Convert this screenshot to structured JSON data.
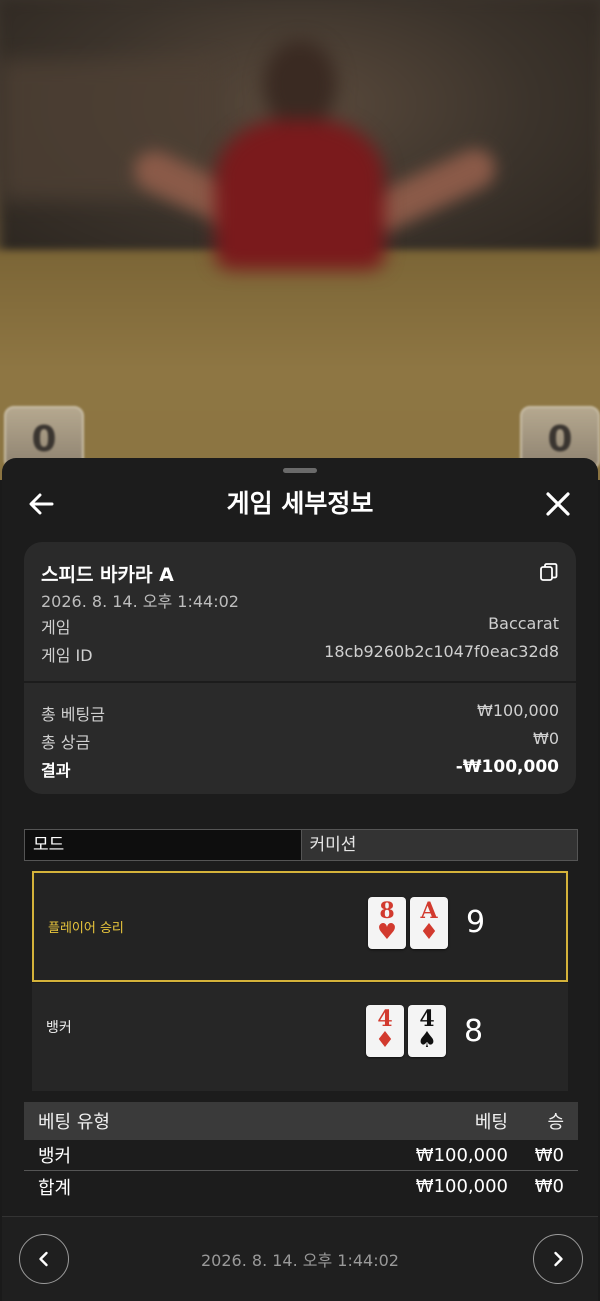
{
  "video": {
    "player_score": "0",
    "banker_score": "0"
  },
  "header": {
    "title": "게임 세부정보"
  },
  "round": {
    "table_name": "스피드 바카라 A",
    "datetime": "2026. 8. 14. 오후 1:44:02",
    "game_label": "게임",
    "game_value": "Baccarat",
    "game_id_label": "게임 ID",
    "game_id_value": "18cb9260b2c1047f0eac32d8"
  },
  "totals": {
    "total_bet_label": "총 베팅금",
    "total_bet_value": "₩100,000",
    "total_payout_label": "총 상금",
    "total_payout_value": "₩0",
    "result_label": "결과",
    "result_value": "-₩100,000"
  },
  "mode": {
    "mode_label": "모드",
    "mode_value": "커미션"
  },
  "hands": {
    "player": {
      "label": "플레이어 승리",
      "score": "9",
      "cards": [
        {
          "rank": "8",
          "suit": "♥",
          "color": "red"
        },
        {
          "rank": "A",
          "suit": "♦",
          "color": "red"
        }
      ]
    },
    "banker": {
      "label": "뱅커",
      "score": "8",
      "cards": [
        {
          "rank": "4",
          "suit": "♦",
          "color": "red"
        },
        {
          "rank": "4",
          "suit": "♠",
          "color": "black"
        }
      ]
    }
  },
  "bets": {
    "headers": {
      "type": "베팅 유형",
      "bet": "베팅",
      "win": "승"
    },
    "rows": [
      {
        "type": "뱅커",
        "bet": "₩100,000",
        "win": "₩0"
      }
    ],
    "total": {
      "type": "합계",
      "bet": "₩100,000",
      "win": "₩0"
    }
  },
  "footer": {
    "datetime": "2026. 8. 14. 오후 1:44:02"
  },
  "colors": {
    "highlight_border": "#d4b23a",
    "player_label": "#e8c53c",
    "card_red": "#d23a2e"
  },
  "icons": [
    "back-arrow-icon",
    "close-icon",
    "copy-icon",
    "chevron-left-icon",
    "chevron-right-icon"
  ]
}
